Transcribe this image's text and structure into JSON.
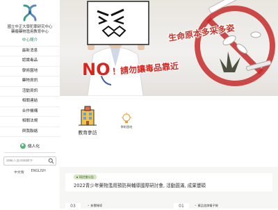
{
  "sidebar": {
    "org_name_line1": "國立中正大學犯罪研究中心",
    "org_name_line2": "藥癮藥物濫用教育中心",
    "nav": [
      {
        "label": "中心簡介"
      },
      {
        "label": "最新消息"
      },
      {
        "label": "認識毒品"
      },
      {
        "label": "學術園地"
      },
      {
        "label": "藥物資訊"
      },
      {
        "label": "活動資訊"
      },
      {
        "label": "相關連結"
      },
      {
        "label": "合作機構"
      },
      {
        "label": "相關法規"
      },
      {
        "label": "與我聯絡"
      }
    ],
    "login_label": "個人化",
    "search_placeholder": "請輸入查詢關鍵字",
    "lang": [
      "中文版",
      "ENGLISH"
    ]
  },
  "hero": {
    "slogan": "生命原本多采多姿",
    "no": "NO",
    "sub": "！請勿讓毒品靠近"
  },
  "quick": {
    "link1_label": "教育參訪",
    "link2_label": "學術園地"
  },
  "news": {
    "tag": "研討會公告",
    "title": "2022青少年藥物濫用預防與輔導國際研討會, 活動圓滿, 成果豐碩",
    "dates": [
      "03",
      "01"
    ],
    "categories": [
      "新聞報導",
      "藥品諮詢電子報"
    ]
  },
  "colors": {
    "accent_green": "#2b8a57",
    "brand_red": "#d8261f"
  }
}
